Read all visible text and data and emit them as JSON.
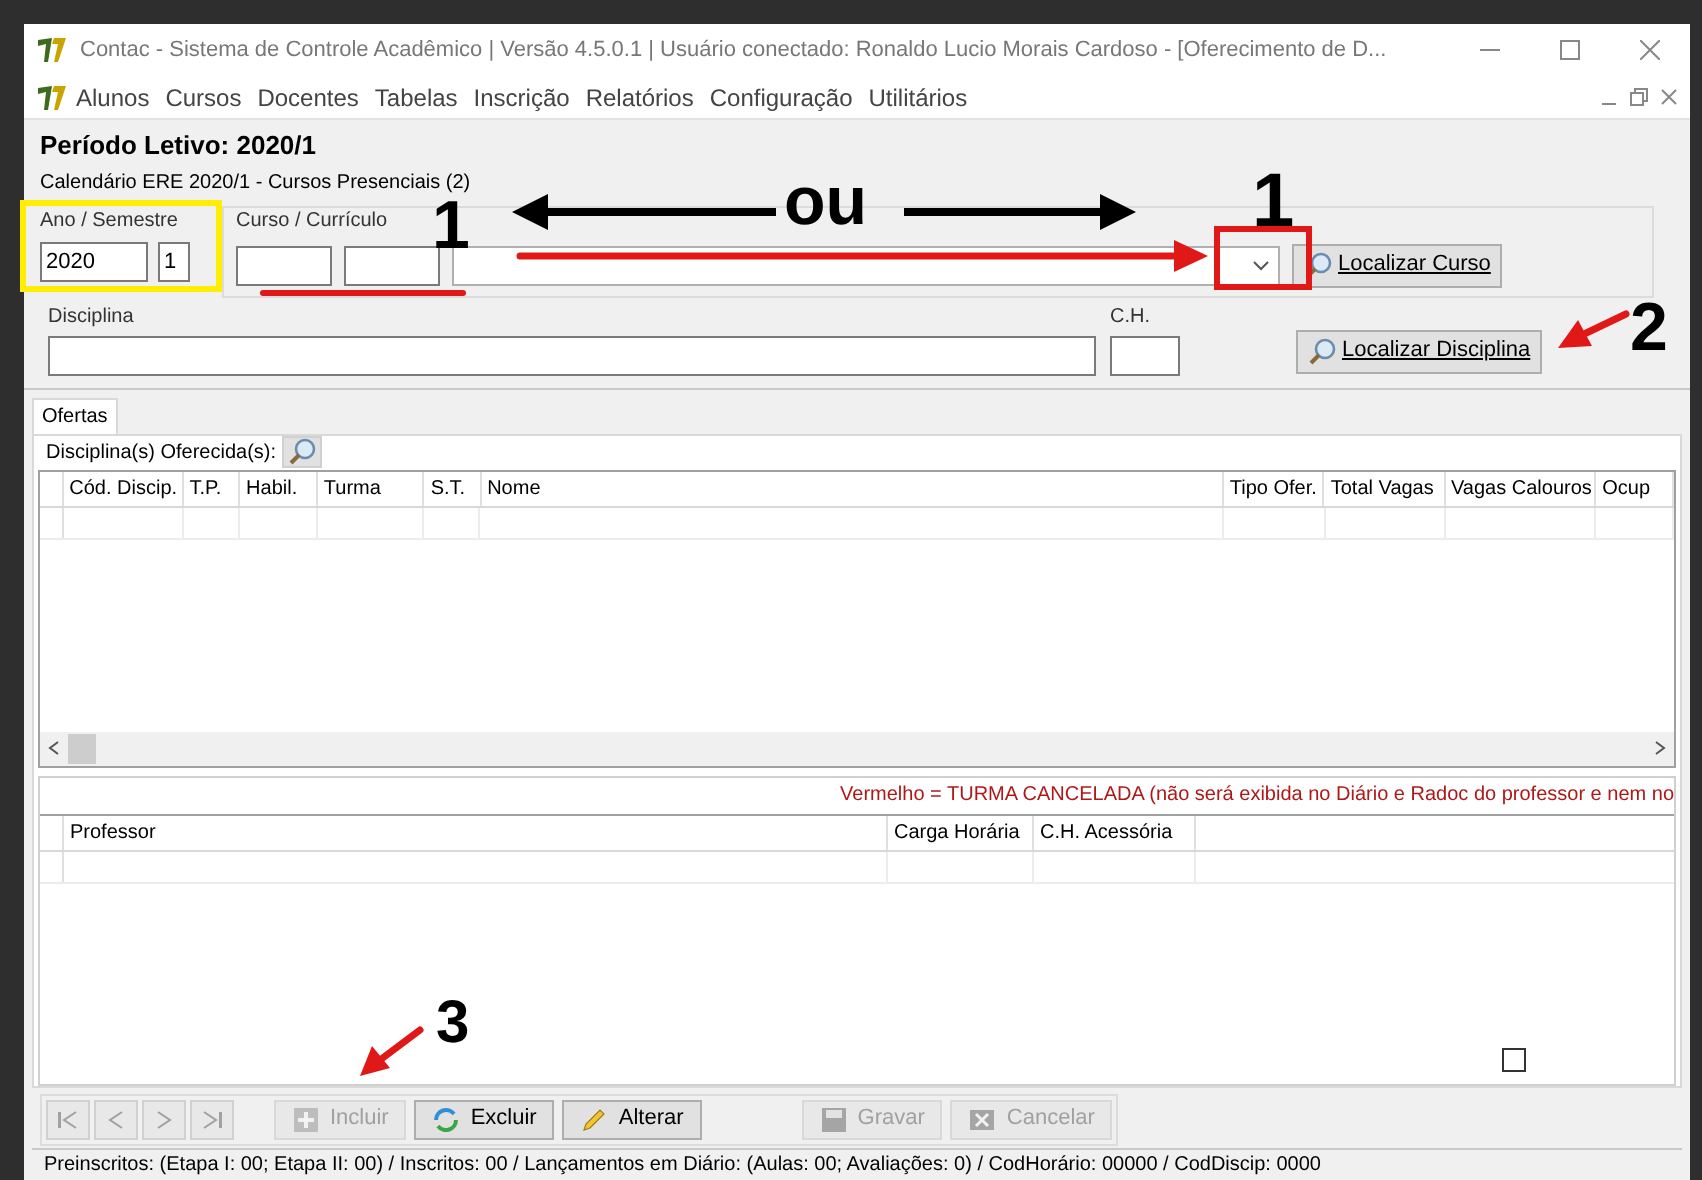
{
  "window": {
    "title": "Contac - Sistema de Controle Acadêmico | Versão 4.5.0.1 | Usuário conectado: Ronaldo Lucio Morais Cardoso - [Oferecimento de D..."
  },
  "menu": [
    "Alunos",
    "Cursos",
    "Docentes",
    "Tabelas",
    "Inscrição",
    "Relatórios",
    "Configuração",
    "Utilitários"
  ],
  "header": {
    "periodo": "Período Letivo: 2020/1",
    "calendario": "Calendário ERE 2020/1 - Cursos Presenciais (2)"
  },
  "ano_semestre": {
    "label": "Ano / Semestre",
    "ano": "2020",
    "semestre": "1"
  },
  "curso": {
    "label": "Curso / Currículo",
    "button": "Localizar Curso"
  },
  "disciplina": {
    "label": "Disciplina",
    "ch_label": "C.H.",
    "button": "Localizar Disciplina"
  },
  "tabs": [
    {
      "label": "Ofertas",
      "selected": true
    }
  ],
  "ofertas": {
    "label": "Disciplina(s) Oferecida(s):",
    "columns": [
      "Cód. Discip.",
      "T.P.",
      "Habil.",
      "Turma",
      "S.T.",
      "Nome",
      "Tipo Ofer.",
      "Total Vagas",
      "Vagas Calouros",
      "Ocup"
    ]
  },
  "warning": "Vermelho = TURMA CANCELADA (não será exibida no Diário e Radoc do professor e nem no",
  "professores": {
    "columns": [
      "Professor",
      "Carga Horária",
      "C.H. Acessória"
    ]
  },
  "checkbox": {
    "checked": false
  },
  "navigation": [
    {
      "kind": "first",
      "disabled": true
    },
    {
      "kind": "prev",
      "disabled": true
    },
    {
      "kind": "next",
      "disabled": true
    },
    {
      "kind": "last",
      "disabled": true
    }
  ],
  "actions": [
    {
      "kind": "add",
      "label": "Incluir",
      "disabled": true
    },
    {
      "kind": "delete",
      "label": "Excluir",
      "disabled": false
    },
    {
      "kind": "edit",
      "label": "Alterar",
      "disabled": false
    },
    {
      "kind": "save",
      "label": "Gravar",
      "disabled": true
    },
    {
      "kind": "cancel",
      "label": "Cancelar",
      "disabled": true
    }
  ],
  "status_bar": "Preinscritos: (Etapa I: 00; Etapa II: 00) / Inscritos: 00 / Lançamentos em Diário: (Aulas: 00; Avaliações: 0) / CodHorário: 00000  / CodDiscip: 0000",
  "annotations": [
    {
      "text": "1"
    },
    {
      "text": "ou"
    },
    {
      "text": "1"
    },
    {
      "text": "2"
    },
    {
      "text": "3"
    }
  ]
}
